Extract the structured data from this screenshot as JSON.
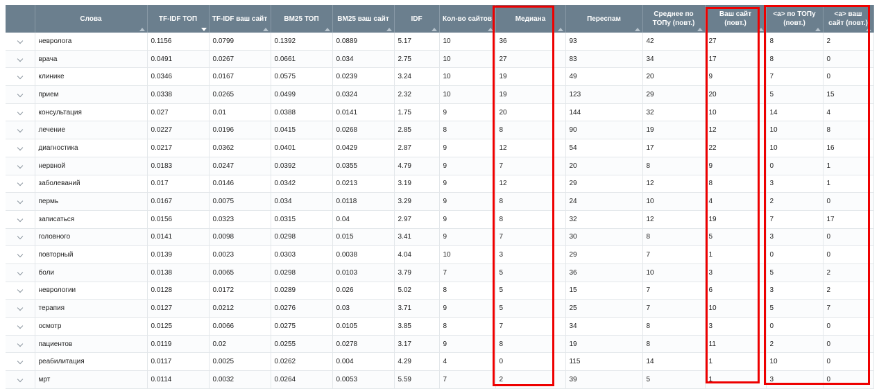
{
  "columns": [
    {
      "key": "expand",
      "label": ""
    },
    {
      "key": "word",
      "label": "Слова"
    },
    {
      "key": "tfidf_top",
      "label": "TF-IDF ТОП"
    },
    {
      "key": "tfidf_site",
      "label": "TF-IDF ваш сайт"
    },
    {
      "key": "bm25_top",
      "label": "BM25 ТОП"
    },
    {
      "key": "bm25_site",
      "label": "BM25 ваш сайт"
    },
    {
      "key": "idf",
      "label": "IDF"
    },
    {
      "key": "sites",
      "label": "Кол-во сайтов"
    },
    {
      "key": "median",
      "label": "Медиана"
    },
    {
      "key": "overspam",
      "label": "Переспам"
    },
    {
      "key": "avg_top",
      "label": "Среднее по ТОПу (повт.)"
    },
    {
      "key": "your_site",
      "label": "Ваш сайт (повт.)"
    },
    {
      "key": "a_top",
      "label": "<a> по ТОПу (повт.)"
    },
    {
      "key": "a_site",
      "label": "<a> ваш сайт (повт.)"
    }
  ],
  "sorted_column": "tfidf_top",
  "rows": [
    [
      "невролога",
      "0.1156",
      "0.0799",
      "0.1392",
      "0.0889",
      "5.17",
      "10",
      "36",
      "93",
      "42",
      "27",
      "8",
      "2"
    ],
    [
      "врача",
      "0.0491",
      "0.0267",
      "0.0661",
      "0.034",
      "2.75",
      "10",
      "27",
      "83",
      "34",
      "17",
      "8",
      "0"
    ],
    [
      "клинике",
      "0.0346",
      "0.0167",
      "0.0575",
      "0.0239",
      "3.24",
      "10",
      "19",
      "49",
      "20",
      "9",
      "7",
      "0"
    ],
    [
      "прием",
      "0.0338",
      "0.0265",
      "0.0499",
      "0.0324",
      "2.32",
      "10",
      "19",
      "123",
      "29",
      "20",
      "5",
      "15"
    ],
    [
      "консультация",
      "0.027",
      "0.01",
      "0.0388",
      "0.0141",
      "1.75",
      "9",
      "20",
      "144",
      "32",
      "10",
      "14",
      "4"
    ],
    [
      "лечение",
      "0.0227",
      "0.0196",
      "0.0415",
      "0.0268",
      "2.85",
      "8",
      "8",
      "90",
      "19",
      "12",
      "10",
      "8"
    ],
    [
      "диагностика",
      "0.0217",
      "0.0362",
      "0.0401",
      "0.0429",
      "2.87",
      "9",
      "12",
      "54",
      "17",
      "22",
      "10",
      "16"
    ],
    [
      "нервной",
      "0.0183",
      "0.0247",
      "0.0392",
      "0.0355",
      "4.79",
      "9",
      "7",
      "20",
      "8",
      "9",
      "0",
      "1"
    ],
    [
      "заболеваний",
      "0.017",
      "0.0146",
      "0.0342",
      "0.0213",
      "3.19",
      "9",
      "12",
      "29",
      "12",
      "8",
      "3",
      "1"
    ],
    [
      "пермь",
      "0.0167",
      "0.0075",
      "0.034",
      "0.0118",
      "3.29",
      "9",
      "8",
      "24",
      "10",
      "4",
      "2",
      "0"
    ],
    [
      "записаться",
      "0.0156",
      "0.0323",
      "0.0315",
      "0.04",
      "2.97",
      "9",
      "8",
      "32",
      "12",
      "19",
      "7",
      "17"
    ],
    [
      "головного",
      "0.0141",
      "0.0098",
      "0.0298",
      "0.015",
      "3.41",
      "9",
      "7",
      "30",
      "8",
      "5",
      "3",
      "0"
    ],
    [
      "повторный",
      "0.0139",
      "0.0023",
      "0.0303",
      "0.0038",
      "4.04",
      "10",
      "3",
      "29",
      "7",
      "1",
      "0",
      "0"
    ],
    [
      "боли",
      "0.0138",
      "0.0065",
      "0.0298",
      "0.0103",
      "3.79",
      "7",
      "5",
      "36",
      "10",
      "3",
      "5",
      "2"
    ],
    [
      "неврологии",
      "0.0128",
      "0.0172",
      "0.0289",
      "0.026",
      "5.02",
      "8",
      "5",
      "15",
      "7",
      "6",
      "3",
      "2"
    ],
    [
      "терапия",
      "0.0127",
      "0.0212",
      "0.0276",
      "0.03",
      "3.71",
      "9",
      "5",
      "25",
      "7",
      "10",
      "5",
      "7"
    ],
    [
      "осмотр",
      "0.0125",
      "0.0066",
      "0.0275",
      "0.0105",
      "3.85",
      "8",
      "7",
      "34",
      "8",
      "3",
      "0",
      "0"
    ],
    [
      "пациентов",
      "0.0119",
      "0.02",
      "0.0255",
      "0.0278",
      "3.17",
      "9",
      "8",
      "19",
      "8",
      "11",
      "2",
      "0"
    ],
    [
      "реабилитация",
      "0.0117",
      "0.0025",
      "0.0262",
      "0.004",
      "4.29",
      "4",
      "0",
      "115",
      "14",
      "1",
      "10",
      "0"
    ],
    [
      "мрт",
      "0.0114",
      "0.0032",
      "0.0264",
      "0.0053",
      "5.59",
      "7",
      "2",
      "39",
      "5",
      "1",
      "3",
      "0"
    ]
  ],
  "highlight_color": "#ee0000",
  "highlighted_columns": [
    "median",
    "your_site",
    "a_top",
    "a_site"
  ]
}
